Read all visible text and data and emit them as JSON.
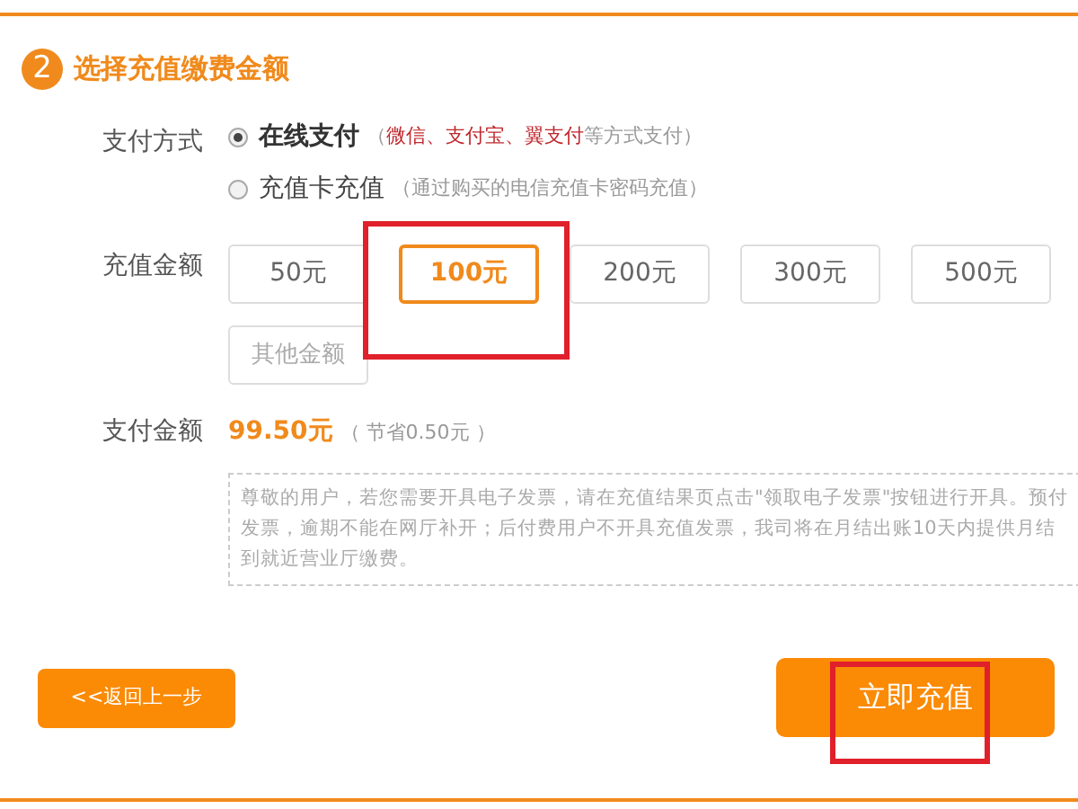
{
  "section": {
    "step": "2",
    "title": "选择充值缴费金额"
  },
  "payment_method": {
    "label": "支付方式",
    "options": [
      {
        "label": "在线支付",
        "selected": true,
        "note_open": "（",
        "note_highlight": "微信、支付宝、翼支付",
        "note_rest": "等方式支付）"
      },
      {
        "label": "充值卡充值",
        "selected": false,
        "note_open": "（",
        "note_rest": "通过购买的电信充值卡密码充值）"
      }
    ]
  },
  "amount": {
    "label": "充值金额",
    "options": [
      {
        "label": "50元",
        "selected": false,
        "kind": "preset"
      },
      {
        "label": "100元",
        "selected": true,
        "kind": "preset"
      },
      {
        "label": "200元",
        "selected": false,
        "kind": "preset"
      },
      {
        "label": "300元",
        "selected": false,
        "kind": "preset"
      },
      {
        "label": "500元",
        "selected": false,
        "kind": "preset"
      },
      {
        "label": "其他金额",
        "selected": false,
        "kind": "custom"
      }
    ]
  },
  "pay_amount": {
    "label": "支付金额",
    "value": "99.50元",
    "saving": "（ 节省0.50元 ）"
  },
  "notice": [
    "尊敬的用户，若您需要开具电子发票，请在充值结果页点击\"领取电子发票\"按钮进行开具。预付",
    "发票，逾期不能在网厅补开；后付费用户不开具充值发票，我司将在月结出账10天内提供月结",
    "到就近营业厅缴费。"
  ],
  "buttons": {
    "back": "<<返回上一步",
    "submit": "立即充值"
  }
}
